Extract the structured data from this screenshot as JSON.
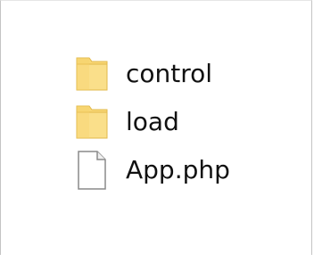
{
  "explorer": {
    "items": [
      {
        "name": "control",
        "type": "folder",
        "icon": "folder-icon"
      },
      {
        "name": "load",
        "type": "folder",
        "icon": "folder-icon"
      },
      {
        "name": "App.php",
        "type": "file",
        "icon": "file-icon"
      }
    ]
  },
  "colors": {
    "folder_fill": "#f8d775",
    "folder_shade": "#e7bf4d",
    "file_fill": "#ffffff",
    "file_stroke": "#8a8a8a",
    "frame_border": "#c4c4c4"
  }
}
